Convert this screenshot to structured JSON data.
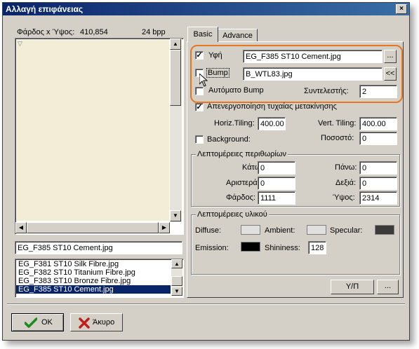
{
  "window": {
    "title": "Αλλαγή επιφάνειας",
    "close_label": "×"
  },
  "left": {
    "size_label": "Φάρδος x Ύψος:",
    "size_value": "410,854",
    "bpp": "24 bpp",
    "filename": "EG_F385 ST10 Cement.jpg",
    "files": [
      "EG_F381 ST10 Silk Fibre.jpg",
      "EG_F382 ST10 Titanium Fibre.jpg",
      "EG_F383 ST10 Bronze Fibre.jpg",
      "EG_F385 ST10 Cement.jpg"
    ],
    "selected_index": 3,
    "preview_color": "#f3edd8"
  },
  "tabs": [
    {
      "label": "Basic",
      "active": true
    },
    {
      "label": "Advance",
      "active": false
    }
  ],
  "basic": {
    "texture": {
      "label": "Υφή",
      "value": "EG_F385 ST10 Cement.jpg",
      "checked": true,
      "browse": "..."
    },
    "bump": {
      "label": "Bump",
      "value": "B_WTL83.jpg",
      "checked": false,
      "collapse": "<<"
    },
    "auto_bump": {
      "label": "Αυτόματο Bump",
      "checked": false,
      "coeff_label": "Συντελεστής:",
      "coeff_value": "2"
    },
    "disable_random": {
      "label": "Απενεργοποίηση τυχαίας μετακίνησης",
      "checked": true
    },
    "horiz_tiling": {
      "label": "Horiz.Tiling:",
      "value": "400.00"
    },
    "vert_tiling": {
      "label": "Vert. Tiling:",
      "value": "400.00"
    },
    "background": {
      "label": "Background:",
      "checked": false,
      "percent_label": "Ποσοστό:",
      "percent_value": "0"
    },
    "margins": {
      "title": "Λεπτομέρειες περιθωρίων",
      "bottom_label": "Κάτω:",
      "bottom_value": "0",
      "top_label": "Πάνω:",
      "top_value": "0",
      "left_label": "Αριστερά:",
      "left_value": "0",
      "right_label": "Δεξιά:",
      "right_value": "0",
      "width_label": "Φάρδος:",
      "width_value": "1111",
      "height_label": "Ύψος:",
      "height_value": "2314"
    },
    "material": {
      "title": "Λεπτομέρειες υλικού",
      "diffuse_label": "Diffuse:",
      "diffuse_color": "#e0e0e0",
      "ambient_label": "Ambient:",
      "ambient_color": "#e0e0e0",
      "specular_label": "Specular:",
      "specular_color": "#3a3a3a",
      "emission_label": "Emission:",
      "emission_color": "#000000",
      "shininess_label": "Shininess:",
      "shininess_value": "128"
    },
    "yp_button": "Υ/Π",
    "more_button": "..."
  },
  "buttons": {
    "ok": "OK",
    "cancel": "Άκυρο"
  },
  "highlight_color": "#e8761e"
}
